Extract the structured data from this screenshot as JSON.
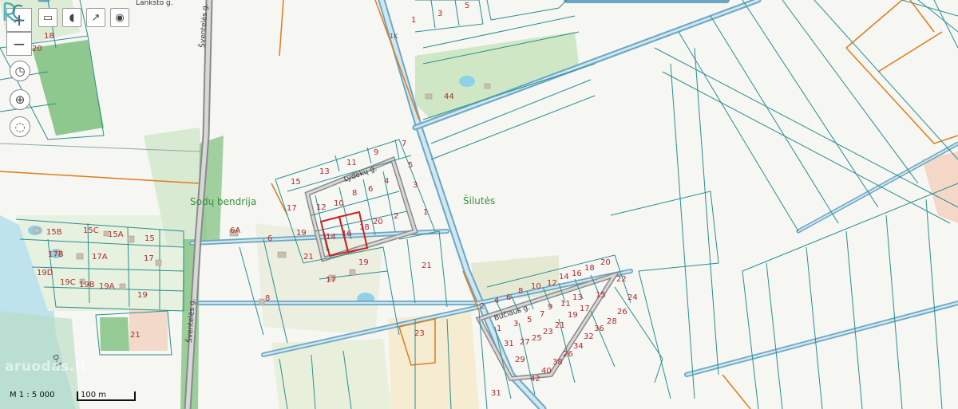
{
  "toolbar": {
    "zoom_in": "+",
    "zoom_out": "−",
    "tools": [
      {
        "icon": "ruler-icon",
        "glyph": "▭"
      },
      {
        "icon": "mouse-icon",
        "glyph": "◖"
      },
      {
        "icon": "export-icon",
        "glyph": "↗"
      },
      {
        "icon": "location-icon",
        "glyph": "◉"
      }
    ],
    "rotate_glyph": "◷",
    "locate_glyph": "⊕",
    "draw_glyph": "◌"
  },
  "scale": {
    "ratio": "M 1 : 5 000",
    "bar_label": "100 m"
  },
  "watermark": "aruodas.lt",
  "labels": {
    "area_siluites": "Šilutės",
    "area_sodu": "Sodų bendrija",
    "street_lydeku": "Lydekų g.",
    "street_buciaus": "Bučiaus g.",
    "street_sventeles": "Šventelės g.",
    "street_lanksto": "Lanksto g.",
    "road_code": "1K",
    "channel": "D-1"
  },
  "parcels": [
    "1",
    "2",
    "3",
    "5",
    "44",
    "15",
    "13",
    "11",
    "9",
    "7",
    "12",
    "10",
    "8",
    "6",
    "4",
    "17",
    "14",
    "16",
    "18",
    "20",
    "2",
    "3",
    "1",
    "5",
    "19",
    "21",
    "19",
    "17",
    "6A",
    "6",
    "8",
    "21",
    "15B",
    "15C",
    "15A",
    "15",
    "17B",
    "17A",
    "17",
    "19D",
    "19C",
    "19B",
    "19A",
    "19",
    "21",
    "18",
    "20",
    "23",
    "31",
    "2",
    "4",
    "6",
    "8",
    "10",
    "12",
    "14",
    "16",
    "18",
    "20",
    "22",
    "24",
    "26",
    "28",
    "1",
    "3",
    "5",
    "7",
    "9",
    "11",
    "13",
    "15",
    "17",
    "19",
    "21",
    "23",
    "25",
    "27",
    "29",
    "31",
    "32",
    "34",
    "36",
    "38",
    "40",
    "42",
    "26"
  ],
  "colors": {
    "parcel_line": "#2a8f8f",
    "road_fill": "#a6cfe3",
    "road_outline": "#6aa7c2",
    "orange_line": "#e07b1a",
    "forest": "#7cc07c",
    "meadow": "#d9ead3",
    "water": "#bfe3ec",
    "sand": "#f0e6c8",
    "selected_parcel": "#cc2222",
    "parcel_label": "#b02a2a"
  }
}
